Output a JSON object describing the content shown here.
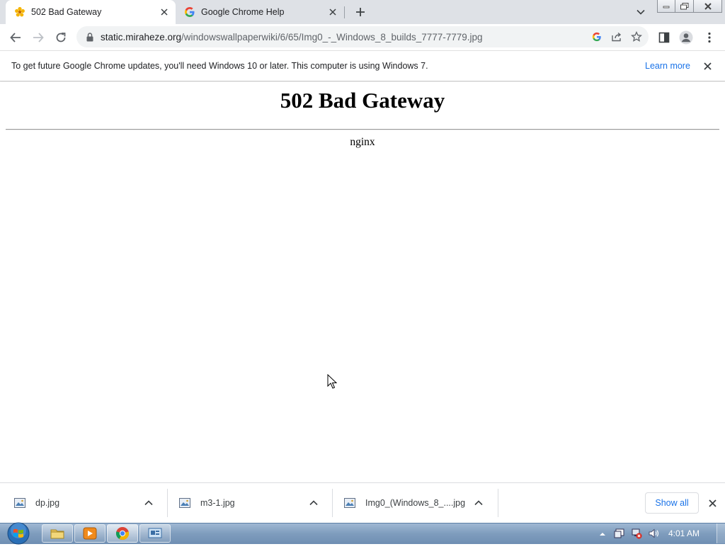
{
  "browser": {
    "tabs": [
      {
        "title": "502 Bad Gateway",
        "favicon": "flower-favicon-icon",
        "active": true
      },
      {
        "title": "Google Chrome Help",
        "favicon": "google-g-icon",
        "active": false
      }
    ],
    "address": {
      "host": "static.miraheze.org",
      "path": "/windowswallpaperwiki/6/65/Img0_-_Windows_8_builds_7777-7779.jpg"
    }
  },
  "infobar": {
    "message": "To get future Google Chrome updates, you'll need Windows 10 or later. This computer is using Windows 7.",
    "link": "Learn more"
  },
  "page": {
    "heading": "502 Bad Gateway",
    "server": "nginx"
  },
  "downloads": {
    "items": [
      {
        "name": "dp.jpg"
      },
      {
        "name": "m3-1.jpg"
      },
      {
        "name": "Img0_(Windows_8_....jpg"
      }
    ],
    "show_all": "Show all"
  },
  "taskbar": {
    "clock": "4:01 AM"
  },
  "colors": {
    "tabstrip_bg": "#dee1e6",
    "omnibox_bg": "#f1f3f4",
    "link_blue": "#1a73e8",
    "taskbar_blue": "#7e9cbd"
  }
}
